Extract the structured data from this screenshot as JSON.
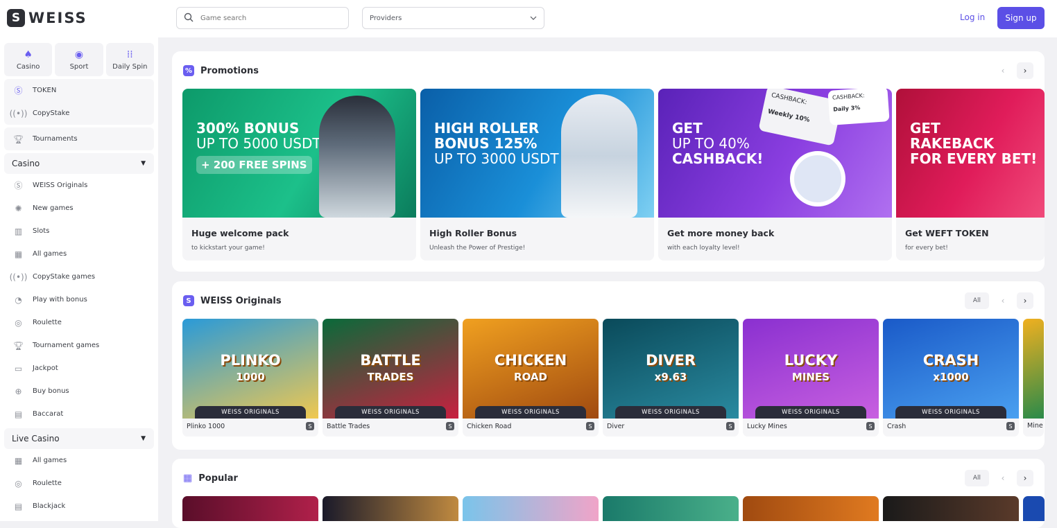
{
  "brand": {
    "logo_mark": "S",
    "logo_text": "WEISS"
  },
  "search": {
    "placeholder": "Game search"
  },
  "providers": {
    "label": "Providers"
  },
  "auth": {
    "login": "Log in",
    "signup": "Sign up"
  },
  "colors": {
    "accent": "#5b4fe6",
    "dark": "#2b2d33"
  },
  "sidebar": {
    "top": [
      {
        "label": "Casino",
        "icon": "spade-icon"
      },
      {
        "label": "Sport",
        "icon": "basketball-icon"
      },
      {
        "label": "Daily Spin",
        "icon": "grid-icon"
      }
    ],
    "extras": [
      {
        "label": "TOKEN",
        "icon": "token-icon"
      },
      {
        "label": "CopyStake",
        "icon": "broadcast-icon"
      }
    ],
    "tournaments": "Tournaments",
    "casino": {
      "title": "Casino",
      "items": [
        "WEISS Originals",
        "New games",
        "Slots",
        "All games",
        "CopyStake games",
        "Play with bonus",
        "Roulette",
        "Tournament games",
        "Jackpot",
        "Buy bonus",
        "Baccarat"
      ]
    },
    "live": {
      "title": "Live Casino",
      "items": [
        "All games",
        "Roulette",
        "Blackjack"
      ]
    }
  },
  "promotions": {
    "title": "Promotions",
    "cards": [
      {
        "line1": "300% BONUS",
        "line2": "UP TO 5000 USDT",
        "badge": "+ 200 FREE SPINS",
        "title": "Huge welcome pack",
        "subtitle": "to kickstart your game!"
      },
      {
        "line1": "HIGH ROLLER",
        "line1b": "BONUS 125%",
        "line2": "UP TO 3000 USDT",
        "title": "High Roller Bonus",
        "subtitle": "Unleash the Power of Prestige!"
      },
      {
        "line1": "GET",
        "line2": "UP TO 40%",
        "line1b": "CASHBACK!",
        "title": "Get more money back",
        "subtitle": "with each loyalty level!",
        "cb1": "CASHBACK:",
        "cb1v": "Weekly 10%",
        "cb2": "CASHBACK:",
        "cb2v": "Daily 3%"
      },
      {
        "line1": "GET",
        "line1b": "RAKEBACK",
        "line1c": "FOR EVERY BET!",
        "title": "Get WEFT TOKEN",
        "subtitle": "for every bet!"
      }
    ]
  },
  "originals": {
    "title": "WEISS Originals",
    "all": "All",
    "tag": "WEISS ORIGINALS",
    "games": [
      {
        "art": "PLINKO",
        "art2": "1000",
        "name": "Plinko 1000"
      },
      {
        "art": "BATTLE",
        "art2": "TRADES",
        "name": "Battle Trades"
      },
      {
        "art": "CHICKEN",
        "art2": "ROAD",
        "name": "Chicken Road"
      },
      {
        "art": "DIVER",
        "art2": "x9.63",
        "name": "Diver"
      },
      {
        "art": "LUCKY",
        "art2": "MINES",
        "name": "Lucky Mines"
      },
      {
        "art": "CRASH",
        "art2": "x1000",
        "name": "Crash"
      },
      {
        "name": "Mine"
      }
    ]
  },
  "popular": {
    "title": "Popular",
    "all": "All"
  }
}
